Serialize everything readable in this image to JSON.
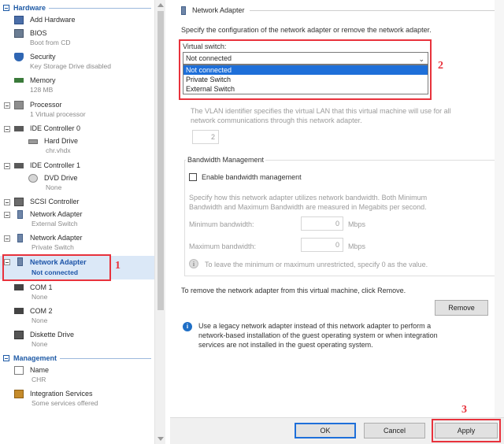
{
  "tree": {
    "hardware_header": "Hardware",
    "management_header": "Management",
    "items": [
      {
        "label": "Add Hardware",
        "sub": ""
      },
      {
        "label": "BIOS",
        "sub": "Boot from CD"
      },
      {
        "label": "Security",
        "sub": "Key Storage Drive disabled"
      },
      {
        "label": "Memory",
        "sub": "128 MB"
      },
      {
        "label": "Processor",
        "sub": "1 Virtual processor"
      },
      {
        "label": "IDE Controller 0",
        "sub": ""
      },
      {
        "label": "Hard Drive",
        "sub": "chr.vhdx"
      },
      {
        "label": "IDE Controller 1",
        "sub": ""
      },
      {
        "label": "DVD Drive",
        "sub": "None"
      },
      {
        "label": "SCSI Controller",
        "sub": ""
      },
      {
        "label": "Network Adapter",
        "sub": "External Switch"
      },
      {
        "label": "Network Adapter",
        "sub": "Private Switch"
      },
      {
        "label": "Network Adapter",
        "sub": "Not connected"
      },
      {
        "label": "COM 1",
        "sub": "None"
      },
      {
        "label": "COM 2",
        "sub": "None"
      },
      {
        "label": "Diskette Drive",
        "sub": "None"
      },
      {
        "label": "Name",
        "sub": "CHR"
      },
      {
        "label": "Integration Services",
        "sub": "Some services offered"
      }
    ]
  },
  "pane": {
    "title": "Network Adapter",
    "description": "Specify the configuration of the network adapter or remove the network adapter.",
    "virtual_switch_label": "Virtual switch:",
    "virtual_switch_value": "Not connected",
    "switch_options": [
      "Not connected",
      "Private Switch",
      "External Switch"
    ],
    "vlan_text_1": "The VLAN identifier specifies the virtual LAN that this virtual machine will use for all",
    "vlan_text_2": "network communications through this network adapter.",
    "vlan_value": "2",
    "bandwidth_title": "Bandwidth Management",
    "bandwidth_check_label": "Enable bandwidth management",
    "bandwidth_desc_1": "Specify how this network adapter utilizes network bandwidth. Both Minimum",
    "bandwidth_desc_2": "Bandwidth and Maximum Bandwidth are measured in Megabits per second.",
    "min_label": "Minimum bandwidth:",
    "min_value": "0",
    "max_label": "Maximum bandwidth:",
    "max_value": "0",
    "unit": "Mbps",
    "unrestricted_note": "To leave the minimum or maximum unrestricted, specify 0 as the value.",
    "remove_text": "To remove the network adapter from this virtual machine, click Remove.",
    "remove_button": "Remove",
    "legacy_note_1": "Use a legacy network adapter instead of this network adapter to perform a",
    "legacy_note_2": "network-based installation of the guest operating system or when integration",
    "legacy_note_3": "services are not installed in the guest operating system."
  },
  "buttons": {
    "ok": "OK",
    "cancel": "Cancel",
    "apply": "Apply"
  },
  "callouts": {
    "one": "1",
    "two": "2",
    "three": "3"
  },
  "icons": {
    "expand": "collapse-box-icon",
    "network": "network-adapter-icon",
    "info": "info-icon",
    "dropdown": "chevron-down-icon"
  },
  "colors": {
    "accent": "#1e6fd9",
    "callout": "#e8323c",
    "section": "#1e5aa6"
  }
}
